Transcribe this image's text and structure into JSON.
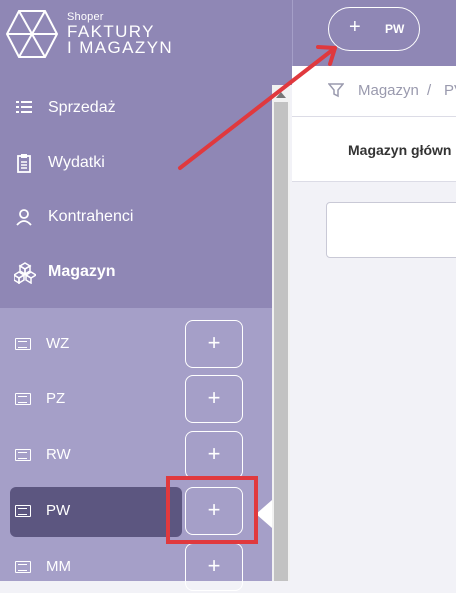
{
  "brand": {
    "sub": "Shoper",
    "main_line1": "FAKTURY",
    "main_line2": "I MAGAZYN"
  },
  "nav": [
    {
      "label": "Sprzedaż",
      "icon": "list-icon"
    },
    {
      "label": "Wydatki",
      "icon": "clipboard-icon"
    },
    {
      "label": "Kontrahenci",
      "icon": "user-icon"
    },
    {
      "label": "Magazyn",
      "icon": "boxes-icon"
    }
  ],
  "sub_items": [
    {
      "label": "WZ",
      "plus": "+"
    },
    {
      "label": "PZ",
      "plus": "+"
    },
    {
      "label": "RW",
      "plus": "+"
    },
    {
      "label": "PW",
      "plus": "+"
    },
    {
      "label": "MM",
      "plus": "+"
    }
  ],
  "header": {
    "pw_button": {
      "plus": "+",
      "label": "PW"
    }
  },
  "breadcrumb": {
    "item1": "Magazyn",
    "sep": "/",
    "item2": "PV"
  },
  "tabs": {
    "label": "Magazyn główn"
  },
  "colors": {
    "sidebar_dark": "#8f87b5",
    "sidebar_light": "#a59fc8",
    "active_row": "#5c5680",
    "annotation_red": "#e0393e"
  }
}
